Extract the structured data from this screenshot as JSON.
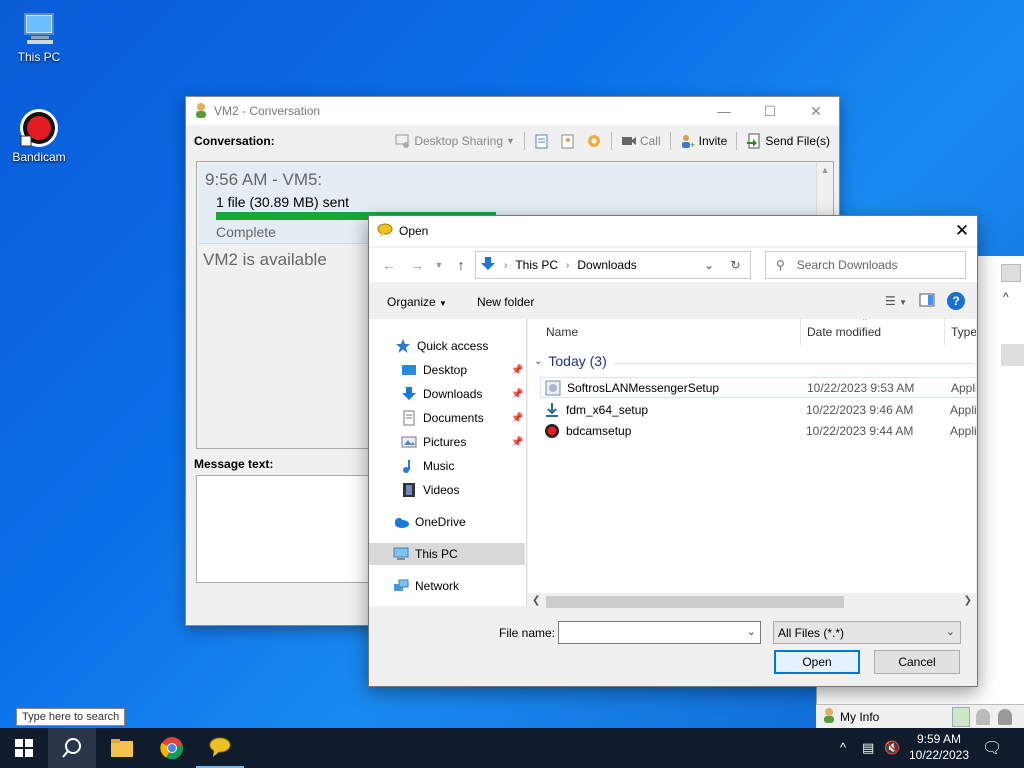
{
  "desktop": {
    "icons": [
      {
        "label": "This PC"
      },
      {
        "label": "Bandicam"
      }
    ]
  },
  "conversation": {
    "title": "VM2 - Conversation",
    "label": "Conversation:",
    "toolbar": {
      "desktop_sharing": "Desktop Sharing",
      "call": "Call",
      "invite": "Invite",
      "send_files": "Send File(s)"
    },
    "message": {
      "time": "9:56 AM - VM5:",
      "file": "1 file (30.89 MB) sent",
      "progress": 1.0,
      "status": "Complete"
    },
    "availability": "VM2 is available",
    "message_text_label": "Message text:"
  },
  "dialog": {
    "title": "Open",
    "breadcrumb": [
      "This PC",
      "Downloads"
    ],
    "search_placeholder": "Search Downloads",
    "organize": "Organize",
    "new_folder": "New folder",
    "nav": {
      "quick_access": "Quick access",
      "items": [
        {
          "label": "Desktop",
          "pinned": true
        },
        {
          "label": "Downloads",
          "pinned": true
        },
        {
          "label": "Documents",
          "pinned": true
        },
        {
          "label": "Pictures",
          "pinned": true
        },
        {
          "label": "Music",
          "pinned": false
        },
        {
          "label": "Videos",
          "pinned": false
        }
      ],
      "onedrive": "OneDrive",
      "this_pc": "This PC",
      "network": "Network"
    },
    "columns": {
      "name": "Name",
      "date": "Date modified",
      "type": "Type"
    },
    "group": "Today (3)",
    "files": [
      {
        "name": "SoftrosLANMessengerSetup",
        "date": "10/22/2023 9:53 AM",
        "type": "Appli"
      },
      {
        "name": "fdm_x64_setup",
        "date": "10/22/2023 9:46 AM",
        "type": "Appli"
      },
      {
        "name": "bdcamsetup",
        "date": "10/22/2023 9:44 AM",
        "type": "Appli"
      }
    ],
    "file_name_label": "File name:",
    "file_name_value": "",
    "filter": "All Files (*.*)",
    "open_button": "Open",
    "cancel_button": "Cancel"
  },
  "side_panel": {
    "my_info": "My Info"
  },
  "taskbar": {
    "search_tooltip": "Type here to search",
    "time": "9:59 AM",
    "date": "10/22/2023"
  },
  "colors": {
    "progress": "#18a838",
    "accent": "#0078d7"
  }
}
